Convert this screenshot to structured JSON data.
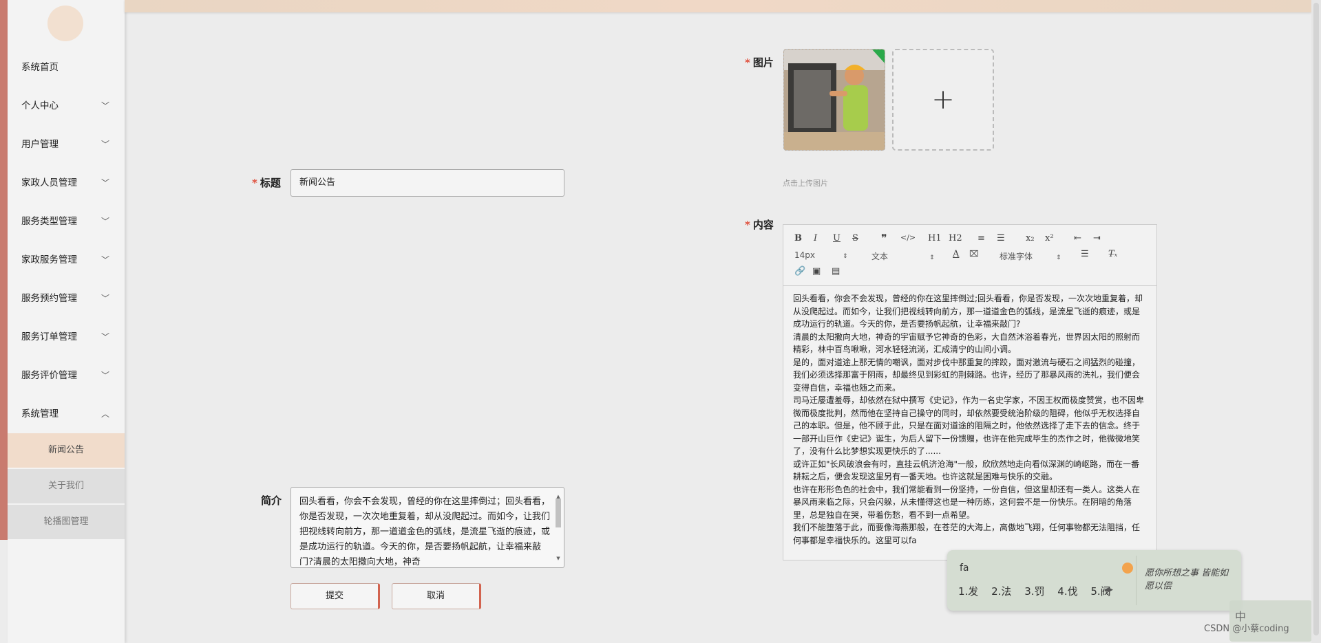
{
  "sidebar": {
    "items": [
      {
        "label": "系统首页",
        "has_children": false
      },
      {
        "label": "个人中心",
        "has_children": true
      },
      {
        "label": "用户管理",
        "has_children": true
      },
      {
        "label": "家政人员管理",
        "has_children": true
      },
      {
        "label": "服务类型管理",
        "has_children": true
      },
      {
        "label": "家政服务管理",
        "has_children": true
      },
      {
        "label": "服务预约管理",
        "has_children": true
      },
      {
        "label": "服务订单管理",
        "has_children": true
      },
      {
        "label": "服务评价管理",
        "has_children": true
      },
      {
        "label": "系统管理",
        "has_children": true,
        "expanded": true
      }
    ],
    "sub_items": [
      {
        "label": "新闻公告",
        "active": true
      },
      {
        "label": "关于我们",
        "active": false
      },
      {
        "label": "轮播图管理",
        "active": false
      }
    ]
  },
  "form": {
    "title_label": "标题",
    "title_value": "新闻公告",
    "summary_label": "简介",
    "summary_value": "回头看看，你会不会发现，曾经的你在这里摔倒过；回头看看，你是否发现，一次次地重复着，却从没爬起过。而如今，让我们把视线转向前方，那一道道金色的弧线，是流星飞逝的痕迹，或是成功运行的轨道。今天的你，是否要扬帆起航，让幸福来敲门?清晨的太阳撒向大地，神奇",
    "image_label": "图片",
    "image_hint": "点击上传图片",
    "content_label": "内容",
    "submit_label": "提交",
    "cancel_label": "取消"
  },
  "editor": {
    "toolbar_row1": [
      "B",
      "I",
      "U",
      "S",
      "❞",
      "</>",
      "H1",
      "H2",
      "≡",
      "☰",
      "x₂",
      "x²",
      "⇤",
      "⇥"
    ],
    "font_size": "14px",
    "text_type": "文本",
    "font_family": "标准字体",
    "paragraphs": [
      "回头看看，你会不会发现，曾经的你在这里摔倒过;回头看看，你是否发现，一次次地重复着，却从没爬起过。而如今，让我们把视线转向前方，那一道道金色的弧线，是流星飞逝的痕迹，或是成功运行的轨道。今天的你，是否要扬帆起航，让幸福来敲门?",
      "清晨的太阳撒向大地，神奇的宇宙赋予它神奇的色彩，大自然沐浴着春光，世界因太阳的照射而精彩，林中百鸟啾啾，河水轻轻流淌，汇成清宁的山间小调。",
      "是的，面对道途上那无情的嘲讽，面对步伐中那重复的摔跤，面对激流与硬石之间猛烈的碰撞，我们必须选择那富于阴雨，却最终见到彩虹的荆棘路。也许，经历了那暴风雨的洗礼，我们便会变得自信，幸福也随之而来。",
      "司马迁屡遭羞辱，却依然在狱中撰写《史记》，作为一名史学家，不因王权而极度赞赏，也不因卑微而极度批判，然而他在坚持自己操守的同时，却依然要受统治阶级的阻碍，他似乎无权选择自己的本职。但是，他不顾于此，只是在面对道途的阻隔之时，他依然选择了走下去的信念。终于一部开山巨作《史记》诞生，为后人留下一份馈赠，也许在他完成毕生的杰作之时，他微微地笑了，没有什么比梦想实现更快乐的了......",
      "或许正如\"长风破浪会有时，直挂云帆济沧海\"一般，欣欣然地走向看似深渊的崎岖路，而在一番耕耘之后，便会发现这里另有一番天地。也许这就是困难与快乐的交融。",
      "也许在形形色色的社会中，我们常能看到一份坚持，一份自信，但这里却还有一类人。这类人在暴风雨来临之际，只会闪躲，从未懂得这也是一种历练，这何尝不是一份快乐。在阴暗的角落里，总是独自在哭，带着伤愁，看不到一点希望。",
      "我们不能堕落于此，而要像海燕那般，在苍茫的大海上，高傲地飞翔，任何事物都无法阻挡，任何事都是幸福快乐的。这里可以fa"
    ]
  },
  "ime": {
    "composition": "fa",
    "candidates": [
      "1.发",
      "2.法",
      "3.罚",
      "4.伐",
      "5.阀"
    ],
    "art_text": "愿你所想之事 皆能如愿以偿",
    "indicator": "中"
  },
  "watermark": "CSDN @小蔡coding",
  "colors": {
    "accent": "#c97b6f",
    "active_sub_bg": "#f1dccb",
    "required": "#e0523f",
    "button_border": "#d2634f"
  }
}
